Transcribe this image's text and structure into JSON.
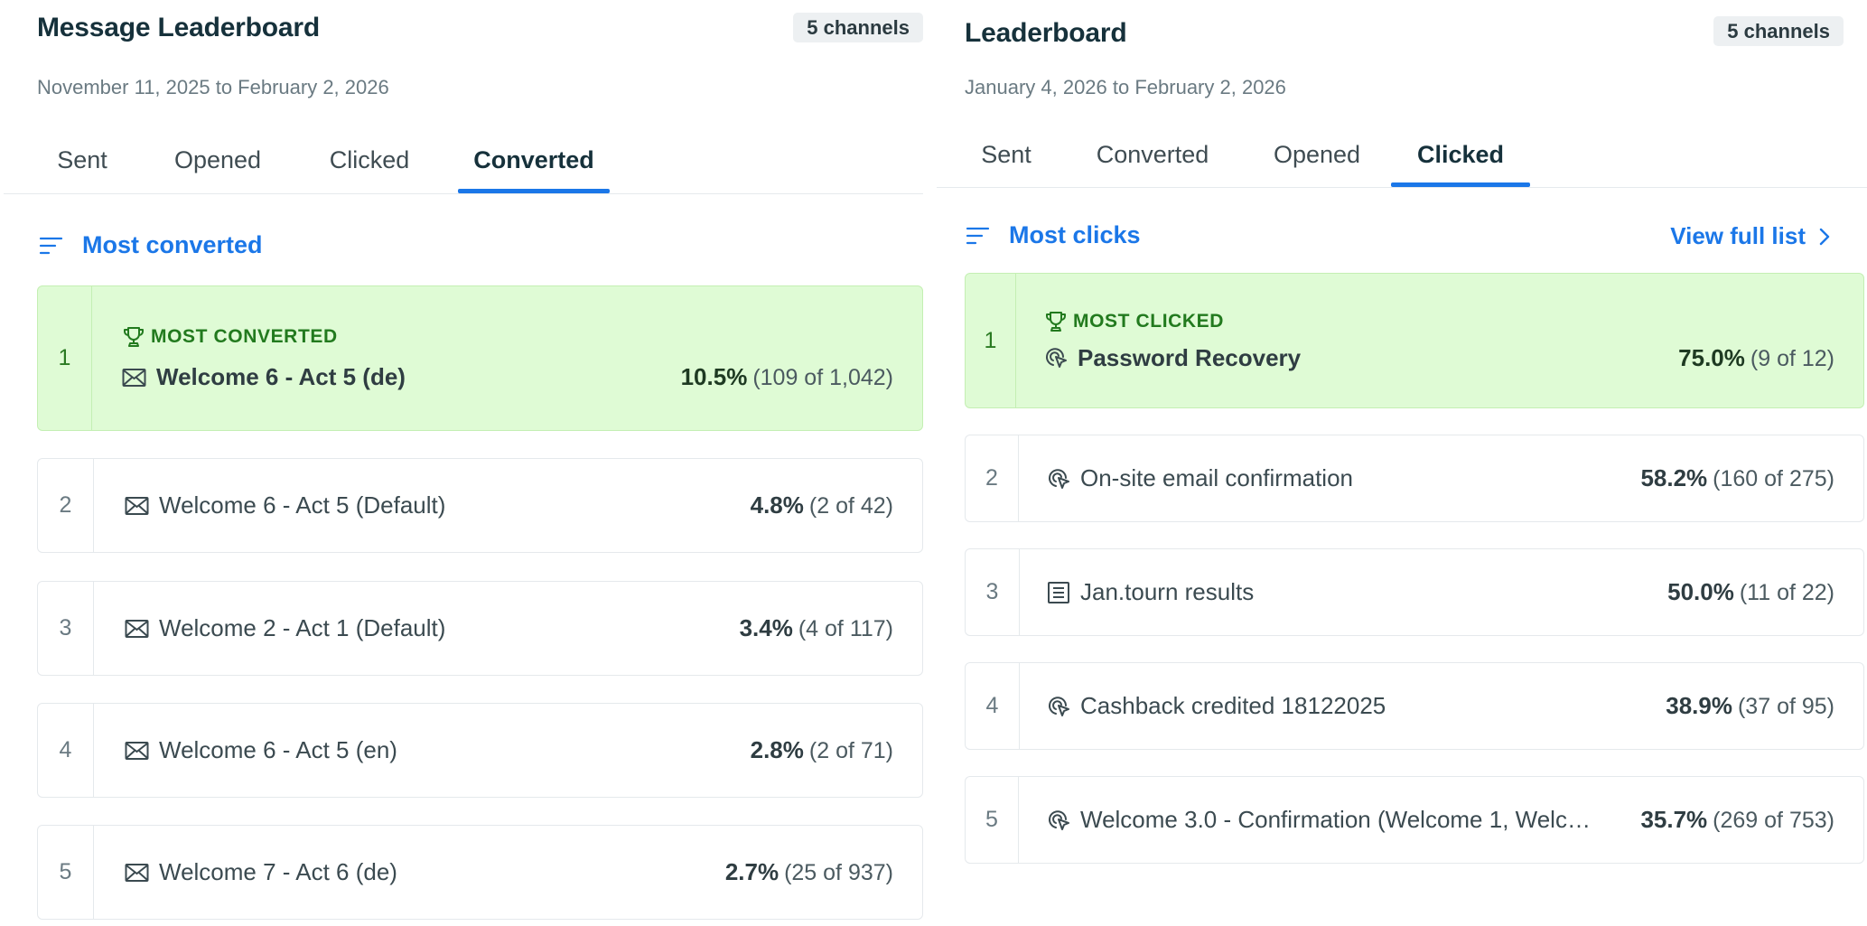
{
  "left": {
    "title": "Message Leaderboard",
    "badge": "5 channels",
    "date_range": "November 11, 2025 to February 2, 2026",
    "tabs": [
      {
        "label": "Sent",
        "active": false
      },
      {
        "label": "Opened",
        "active": false
      },
      {
        "label": "Clicked",
        "active": false
      },
      {
        "label": "Converted",
        "active": true
      }
    ],
    "sort_label": "Most converted",
    "top_label": "MOST CONVERTED",
    "items": [
      {
        "rank": "1",
        "icon": "envelope-icon",
        "name": "Welcome 6 - Act 5 (de)",
        "pct": "10.5%",
        "detail": "(109 of 1,042)"
      },
      {
        "rank": "2",
        "icon": "envelope-icon",
        "name": "Welcome 6 - Act 5 (Default)",
        "pct": "4.8%",
        "detail": "(2 of 42)"
      },
      {
        "rank": "3",
        "icon": "envelope-icon",
        "name": "Welcome 2 - Act 1 (Default)",
        "pct": "3.4%",
        "detail": "(4 of 117)"
      },
      {
        "rank": "4",
        "icon": "envelope-icon",
        "name": "Welcome 6 - Act 5 (en)",
        "pct": "2.8%",
        "detail": "(2 of 71)"
      },
      {
        "rank": "5",
        "icon": "envelope-icon",
        "name": "Welcome 7 - Act 6 (de)",
        "pct": "2.7%",
        "detail": "(25 of 937)"
      }
    ]
  },
  "right": {
    "title": "Leaderboard",
    "badge": "5 channels",
    "date_range": "January 4, 2026 to February 2, 2026",
    "tabs": [
      {
        "label": "Sent",
        "active": false
      },
      {
        "label": "Converted",
        "active": false
      },
      {
        "label": "Opened",
        "active": false
      },
      {
        "label": "Clicked",
        "active": true
      }
    ],
    "sort_label": "Most clicks",
    "view_full_label": "View full list",
    "top_label": "MOST CLICKED",
    "items": [
      {
        "rank": "1",
        "icon": "cursor-click-icon",
        "name": "Password Recovery",
        "pct": "75.0%",
        "detail": "(9 of 12)"
      },
      {
        "rank": "2",
        "icon": "cursor-click-icon",
        "name": "On-site email confirmation",
        "pct": "58.2%",
        "detail": "(160 of 275)"
      },
      {
        "rank": "3",
        "icon": "document-list-icon",
        "name": "Jan.tourn results",
        "pct": "50.0%",
        "detail": "(11 of 22)"
      },
      {
        "rank": "4",
        "icon": "cursor-click-icon",
        "name": "Cashback credited 18122025",
        "pct": "38.9%",
        "detail": "(37 of 95)"
      },
      {
        "rank": "5",
        "icon": "cursor-click-icon",
        "name": "Welcome 3.0 - Confirmation (Welcome 1, Welc…",
        "pct": "35.7%",
        "detail": "(269 of 753)"
      }
    ]
  },
  "colors": {
    "accent": "#1b77e8",
    "top_background": "#dffbd5",
    "top_text": "#227a1e"
  }
}
